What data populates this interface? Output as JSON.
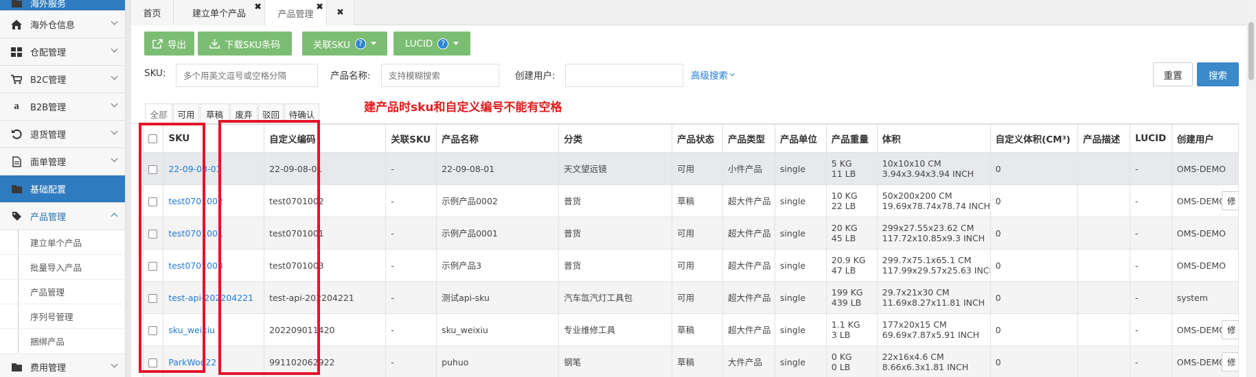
{
  "sidebar": {
    "items": [
      {
        "label": "海外服务",
        "icon": "folder-icon"
      },
      {
        "label": "海外仓信息",
        "icon": "home-icon"
      },
      {
        "label": "仓配管理",
        "icon": "grid-icon"
      },
      {
        "label": "B2C管理",
        "icon": "cart-icon"
      },
      {
        "label": "B2B管理",
        "icon": "amazon-icon"
      },
      {
        "label": "退货管理",
        "icon": "undo-icon"
      },
      {
        "label": "面单管理",
        "icon": "document-icon"
      },
      {
        "label": "基础配置",
        "icon": "folder-icon"
      },
      {
        "label": "产品管理",
        "icon": "tag-icon"
      }
    ],
    "sub_items": [
      "建立单个产品",
      "批量导入产品",
      "产品管理",
      "序列号管理",
      "捆绑产品"
    ],
    "next_label": "费用管理"
  },
  "tabs": [
    {
      "label": "首页"
    },
    {
      "label": "建立单个产品"
    },
    {
      "label": "产品管理"
    }
  ],
  "toolbar": {
    "export": "导出",
    "download_sku": "下载SKU条码",
    "link_sku": "关联SKU",
    "lucid": "LUCID"
  },
  "search": {
    "sku_label": "SKU:",
    "sku_placeholder": "多个用英文逗号或空格分隔",
    "name_label": "产品名称:",
    "name_placeholder": "支持模糊搜索",
    "user_label": "创建用户:",
    "advanced": "高级搜索",
    "reset": "重置",
    "search": "搜索"
  },
  "status_tabs": [
    "全部",
    "可用",
    "草稿",
    "废弃",
    "驳回",
    "待确认"
  ],
  "annotation": "建产品时sku和自定义编号不能有空格",
  "table": {
    "headers": [
      "SKU",
      "自定义编码",
      "关联SKU",
      "产品名称",
      "分类",
      "产品状态",
      "产品类型",
      "产品单位",
      "产品重量",
      "体积",
      "自定义体积(CM³)",
      "产品描述",
      "LUCID",
      "创建用户"
    ],
    "edit_label": "修",
    "rows": [
      {
        "sku": "22-09-08-01",
        "code": "22-09-08-01",
        "link": "-",
        "name": "22-09-08-01",
        "cat": "天文望远镜",
        "status": "可用",
        "type": "小件产品",
        "unit": "single",
        "w1": "5 KG",
        "w2": "11 LB",
        "v1": "10x10x10 CM",
        "v2": "3.94x3.94x3.94 INCH",
        "cv": "0",
        "desc": "",
        "lucid": "-",
        "user": "OMS-DEMO"
      },
      {
        "sku": "test0701002",
        "code": "test0701002",
        "link": "-",
        "name": "示例产品0002",
        "cat": "普货",
        "status": "草稿",
        "type": "超大件产品",
        "unit": "single",
        "w1": "10 KG",
        "w2": "22 LB",
        "v1": "50x200x200 CM",
        "v2": "19.69x78.74x78.74 INCH",
        "cv": "0",
        "desc": "",
        "lucid": "-",
        "user": "OMS-DEMO"
      },
      {
        "sku": "test0701001",
        "code": "test0701001",
        "link": "-",
        "name": "示例产品0001",
        "cat": "普货",
        "status": "可用",
        "type": "超大件产品",
        "unit": "single",
        "w1": "20 KG",
        "w2": "45 LB",
        "v1": "299x27.55x23.62 CM",
        "v2": "117.72x10.85x9.3 INCH",
        "cv": "0",
        "desc": "",
        "lucid": "-",
        "user": "OMS-DEMO"
      },
      {
        "sku": "test0701003",
        "code": "test0701003",
        "link": "-",
        "name": "示例产品3",
        "cat": "普货",
        "status": "可用",
        "type": "超大件产品",
        "unit": "single",
        "w1": "20.9 KG",
        "w2": "47 LB",
        "v1": "299.7x75.1x65.1 CM",
        "v2": "117.99x29.57x25.63 INCH",
        "cv": "0",
        "desc": "",
        "lucid": "-",
        "user": "OMS-DEMO"
      },
      {
        "sku": "test-api-202204221",
        "code": "test-api-202204221",
        "link": "-",
        "name": "测试api-sku",
        "cat": "汽车氙汽灯工具包",
        "status": "可用",
        "type": "超大件产品",
        "unit": "single",
        "w1": "199 KG",
        "w2": "439 LB",
        "v1": "29.7x21x30 CM",
        "v2": "11.69x8.27x11.81 INCH",
        "cv": "0",
        "desc": "",
        "lucid": "-",
        "user": "system"
      },
      {
        "sku": "sku_weixiu",
        "code": "202209011420",
        "link": "-",
        "name": "sku_weixiu",
        "cat": "专业维修工具",
        "status": "草稿",
        "type": "超大件产品",
        "unit": "single",
        "w1": "1.1 KG",
        "w2": "3 LB",
        "v1": "177x20x15 CM",
        "v2": "69.69x7.87x5.91 INCH",
        "cv": "0",
        "desc": "",
        "lucid": "-",
        "user": "OMS-DEMO"
      },
      {
        "sku": "ParkWoo22",
        "code": "991102062922",
        "link": "-",
        "name": "puhuo",
        "cat": "钢笔",
        "status": "草稿",
        "type": "大件产品",
        "unit": "single",
        "w1": "0 KG",
        "w2": "0 LB",
        "v1": "22x16x4.6 CM",
        "v2": "8.66x6.3x1.81 INCH",
        "cv": "0",
        "desc": "",
        "lucid": "-",
        "user": "OMS-DEMO"
      }
    ]
  }
}
